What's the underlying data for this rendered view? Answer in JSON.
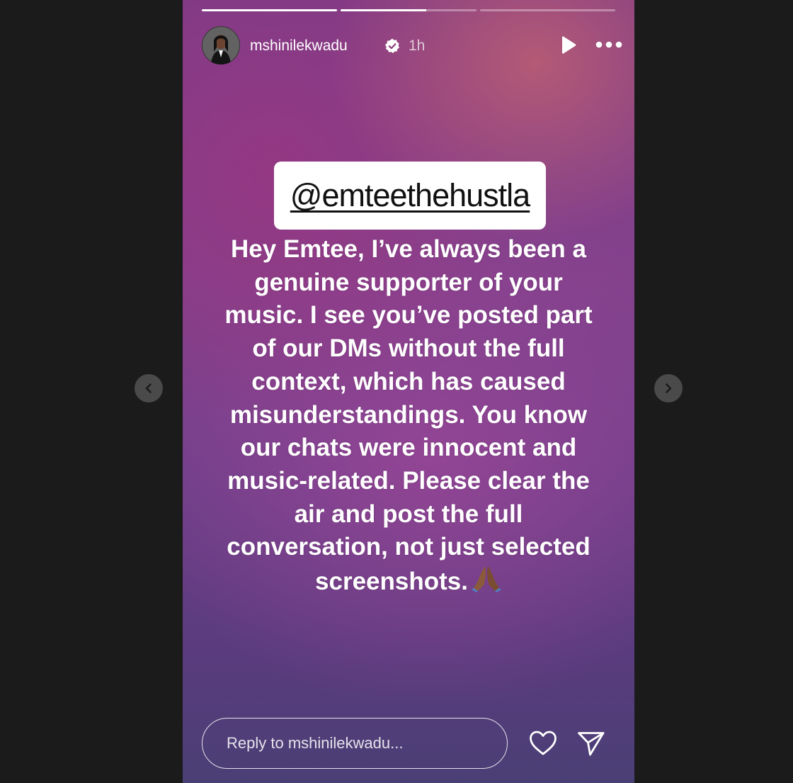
{
  "story": {
    "progress": [
      {
        "fill": 1.0
      },
      {
        "fill": 0.63
      },
      {
        "fill": 0.0
      }
    ],
    "header": {
      "username": "mshinilekwadu",
      "time": "1h",
      "verified": true
    },
    "mention": "@emteethehustla",
    "caption_lines": [
      "Hey Emtee, I’ve always been a",
      "genuine supporter of your",
      "music. I see you’ve posted part",
      "of our DMs without the full",
      "context, which has caused",
      "misunderstandings. You know",
      "our chats were innocent and",
      "music-related. Please clear the",
      "air and post the full",
      "conversation, not just selected",
      "screenshots."
    ],
    "caption_emoji": "pray-emoji",
    "reply_placeholder": "Reply to mshinilekwadu..."
  },
  "icons": {
    "play": "play-icon",
    "more": "more-icon",
    "heart": "heart-icon",
    "send": "send-icon",
    "prev": "chevron-left-icon",
    "next": "chevron-right-icon",
    "verified": "verified-badge-icon"
  },
  "colors": {
    "page_bg": "#1b1b1b",
    "nav_button_bg": "#4a4a4a",
    "story_gradient_top": "#7d3b86",
    "story_gradient_bottom": "#4a3f75"
  }
}
